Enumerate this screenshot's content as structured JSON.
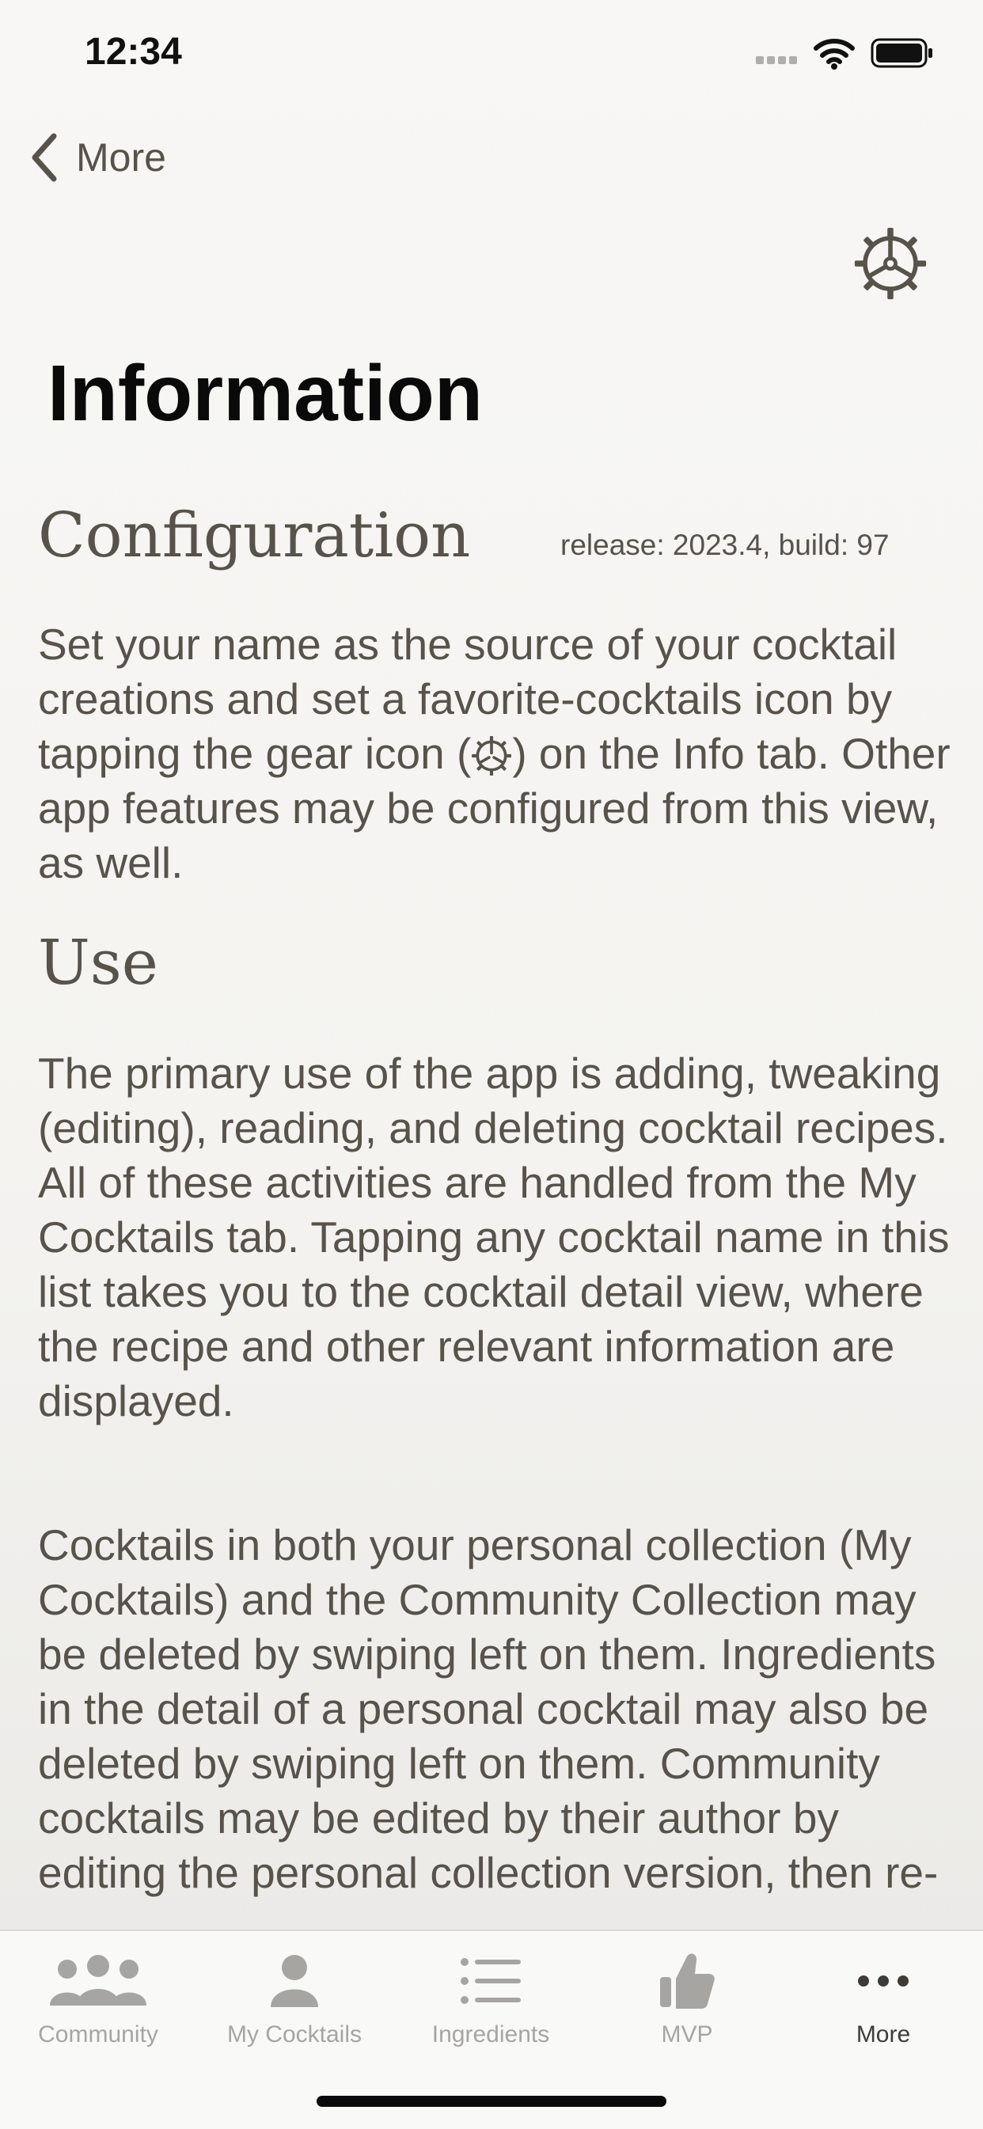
{
  "status": {
    "time": "12:34"
  },
  "nav": {
    "back_label": "More"
  },
  "page": {
    "title": "Information"
  },
  "config": {
    "heading": "Configuration",
    "version": "release: 2023.4, build: 97",
    "para_before_icon": "Set your name as the source of your cocktail creations and set a favorite-cocktails icon by tapping the gear icon (",
    "para_after_icon": ") on the Info tab. Other app features may be configured from this view, as well."
  },
  "use": {
    "heading": "Use",
    "para1": "The primary use of the app is adding, tweaking (editing), reading, and deleting cocktail recipes. All of these activities are handled from the My Cocktails tab. Tapping any cocktail name in this list takes you to the cocktail detail view, where the recipe and other relevant information are displayed.",
    "para2": "Cocktails in both your personal collection (My Cocktails) and the Community Collection may be deleted by swiping left on them. Ingredients in the detail of a personal cocktail may also be deleted by swiping left on them. Community cocktails may be edited by their author by editing the personal collection version, then re-"
  },
  "tabs": [
    {
      "label": "Community",
      "icon": "people-icon"
    },
    {
      "label": "My Cocktails",
      "icon": "person-icon"
    },
    {
      "label": "Ingredients",
      "icon": "list-icon"
    },
    {
      "label": "MVP",
      "icon": "thumbs-up-icon"
    },
    {
      "label": "More",
      "icon": "ellipsis-icon"
    }
  ],
  "active_tab": "More",
  "colors": {
    "text": "#57534b",
    "title": "#0a0a0a",
    "tab_inactive": "#a7a5a1",
    "tab_active": "#3f3c37"
  }
}
